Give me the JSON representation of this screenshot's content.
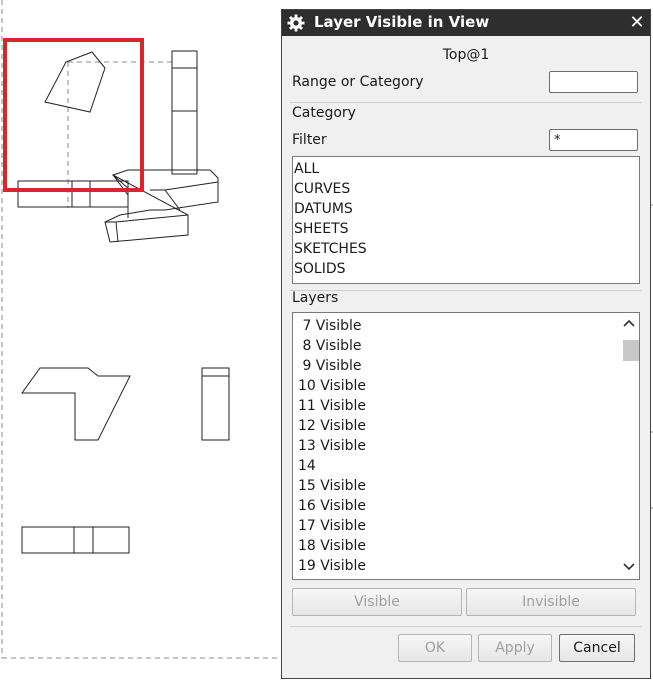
{
  "dialog": {
    "title": "Layer Visible in View",
    "title_icon": "gear-icon",
    "close_label": "✕",
    "view_name": "Top@1",
    "range_label": "Range or Category",
    "range_value": "",
    "category_heading": "Category",
    "filter_label": "Filter",
    "filter_value": "*",
    "categories": [
      "ALL",
      "CURVES",
      "DATUMS",
      "SHEETS",
      "SKETCHES",
      "SOLIDS"
    ],
    "layers_heading": "Layers",
    "layers": [
      " 7 Visible",
      " 8 Visible",
      " 9 Visible",
      "10 Visible",
      "11 Visible",
      "12 Visible",
      "13 Visible",
      "14",
      "15 Visible",
      "16 Visible",
      "17 Visible",
      "18 Visible",
      "19 Visible"
    ],
    "visible_button": "Visible",
    "invisible_button": "Invisible",
    "ok_button": "OK",
    "apply_button": "Apply",
    "cancel_button": "Cancel"
  },
  "colors": {
    "titlebar": "#2e2e2e",
    "dialog_bg": "#f0f0f0",
    "selection_box": "#d9262c"
  }
}
